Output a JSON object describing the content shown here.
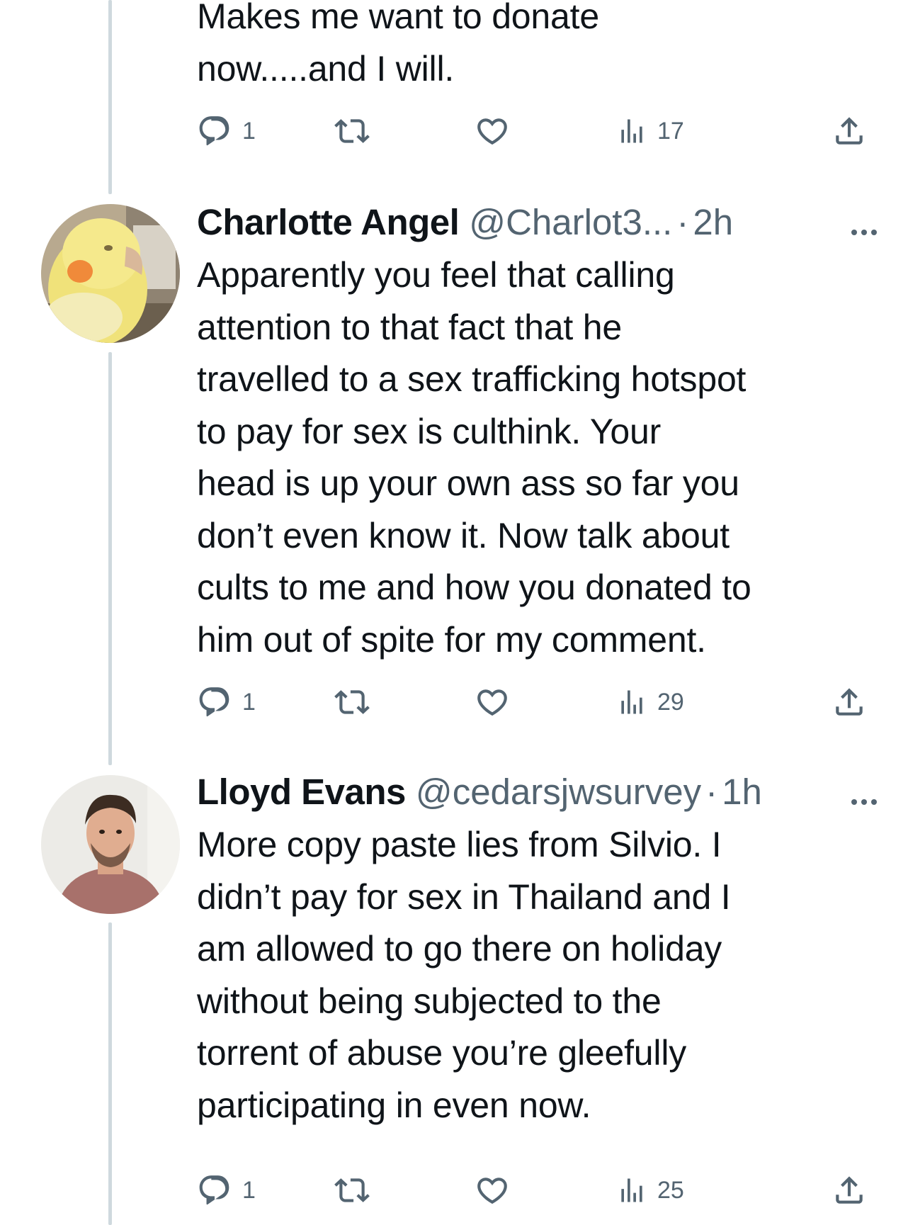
{
  "tweets": [
    {
      "text": "Makes me want to donate\nnow.....and I will.",
      "actions": {
        "replies": "1",
        "retweets": "",
        "likes": "",
        "views": "17"
      }
    },
    {
      "name": "Charlotte Angel",
      "handle": "@Charlot3...",
      "separator": "·",
      "time": "2h",
      "text": "Apparently you feel that calling\nattention to that fact that he\ntravelled to a sex trafficking hotspot\nto pay for sex is culthink.  Your\nhead is up your own ass so far you\ndon’t even know it. Now talk about\ncults to me and how you donated to\nhim out of spite for my comment.",
      "actions": {
        "replies": "1",
        "retweets": "",
        "likes": "",
        "views": "29"
      }
    },
    {
      "name": "Lloyd Evans",
      "handle": "@cedarsjwsurvey",
      "separator": "·",
      "time": "1h",
      "text": "More copy paste lies from Silvio. I\ndidn’t pay for sex in Thailand and I\nam allowed to go there on holiday\nwithout being subjected to the\ntorrent of abuse you’re gleefully\nparticipating in even now.",
      "actions": {
        "replies": "1",
        "retweets": "",
        "likes": "",
        "views": "25"
      }
    }
  ],
  "icons": {
    "reply": "reply-icon",
    "retweet": "retweet-icon",
    "like": "heart-icon",
    "views": "views-icon",
    "share": "share-icon",
    "more": "more-icon"
  },
  "colors": {
    "text": "#0f1419",
    "secondary": "#536471",
    "thread_line": "#cfd9de",
    "background": "#ffffff"
  }
}
